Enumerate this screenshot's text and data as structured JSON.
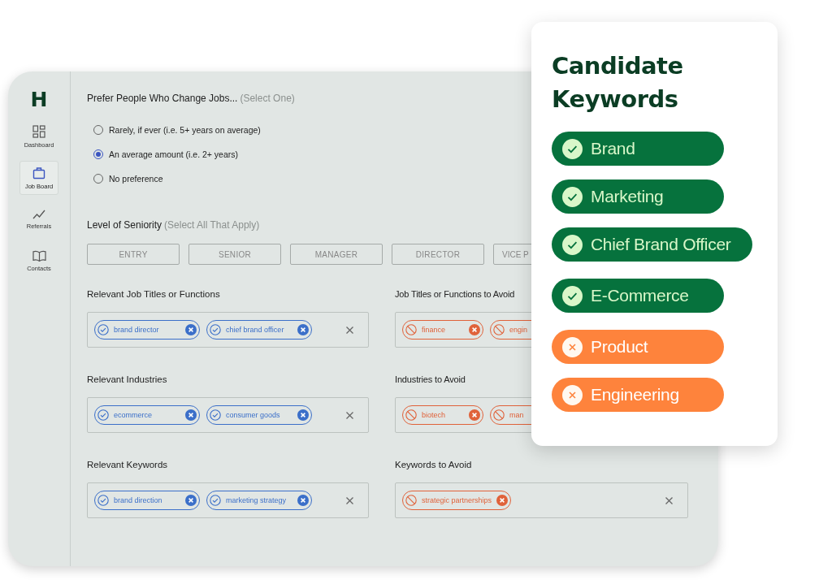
{
  "sidebar": {
    "logo": "H",
    "items": [
      {
        "label": "Dashboard",
        "kind": "grid",
        "selected": false
      },
      {
        "label": "Job Board",
        "kind": "briefcase",
        "selected": true
      },
      {
        "label": "Referrals",
        "kind": "trend",
        "selected": false
      },
      {
        "label": "Contacts",
        "kind": "book",
        "selected": false
      }
    ]
  },
  "job_change": {
    "title": "Prefer People Who Change Jobs...",
    "hint": "(Select One)",
    "options": [
      {
        "label": "Rarely, if ever (i.e. 5+ years on average)",
        "selected": false
      },
      {
        "label": "An average amount (i.e. 2+ years)",
        "selected": true
      },
      {
        "label": "No preference",
        "selected": false
      }
    ]
  },
  "seniority": {
    "title": "Level of Seniority",
    "hint": "(Select All That Apply)",
    "levels": [
      {
        "label": "ENTRY",
        "selected": false
      },
      {
        "label": "SENIOR",
        "selected": false
      },
      {
        "label": "MANAGER",
        "selected": false
      },
      {
        "label": "DIRECTOR",
        "selected": false
      },
      {
        "label": "VICE P",
        "selected": false
      }
    ]
  },
  "filters": [
    {
      "title": "Relevant Job Titles or Functions",
      "kind": "include",
      "tags": [
        "brand director",
        "chief brand officer"
      ]
    },
    {
      "title": "Job Titles or Functions to Avoid",
      "kind": "avoid",
      "tags": [
        "finance",
        "engin"
      ]
    },
    {
      "title": "Relevant Industries",
      "kind": "include",
      "tags": [
        "ecommerce",
        "consumer goods"
      ]
    },
    {
      "title": "Industries to Avoid",
      "kind": "avoid",
      "tags": [
        "biotech",
        "man"
      ]
    },
    {
      "title": "Relevant Keywords",
      "kind": "include",
      "tags": [
        "brand direction",
        "marketing strategy"
      ]
    },
    {
      "title": "Keywords to Avoid",
      "kind": "avoid",
      "tags": [
        "strategic partnerships"
      ]
    }
  ],
  "keywords_card": {
    "title": "Candidate Keywords",
    "keywords": [
      {
        "label": "Brand",
        "kind": "match"
      },
      {
        "label": "Marketing",
        "kind": "match"
      },
      {
        "label": "Chief Brand Officer",
        "kind": "match"
      },
      {
        "label": "E-Commerce",
        "kind": "match"
      },
      {
        "label": "Product",
        "kind": "reject"
      },
      {
        "label": "Engineering",
        "kind": "reject"
      }
    ]
  }
}
